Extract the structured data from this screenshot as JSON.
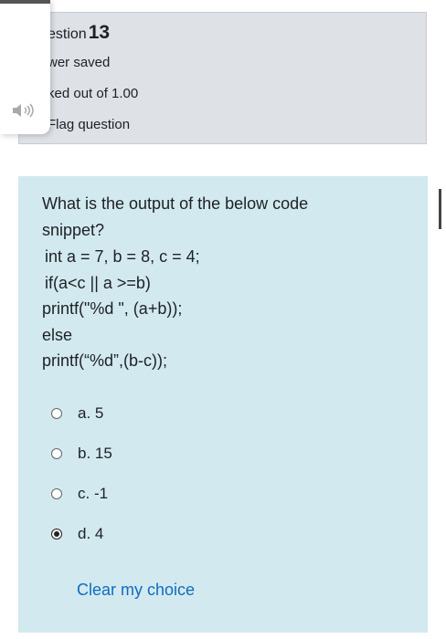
{
  "info": {
    "question_word": "estion",
    "question_number": "13",
    "state": "wer saved",
    "grade": "ked out of 1.00",
    "flag_label": "Flag question"
  },
  "question": {
    "lines": [
      "What is the output of the below code",
      "snippet?",
      "int a = 7, b = 8, c = 4;",
      "if(a<c || a >=b)",
      "printf(\"%d \", (a+b));",
      "else",
      "printf(“%d”,(b-c));"
    ]
  },
  "options": [
    {
      "label": "a. 5",
      "checked": false
    },
    {
      "label": "b. 15",
      "checked": false
    },
    {
      "label": "c. -1",
      "checked": false
    },
    {
      "label": "d. 4",
      "checked": true
    }
  ],
  "clear_choice": "Clear my choice",
  "colors": {
    "info_bg": "#dee2e6",
    "content_bg": "#d2e9ef",
    "link": "#0f6cbf"
  },
  "icons": {
    "speaker": "speaker-icon",
    "flag": "flag-icon"
  }
}
